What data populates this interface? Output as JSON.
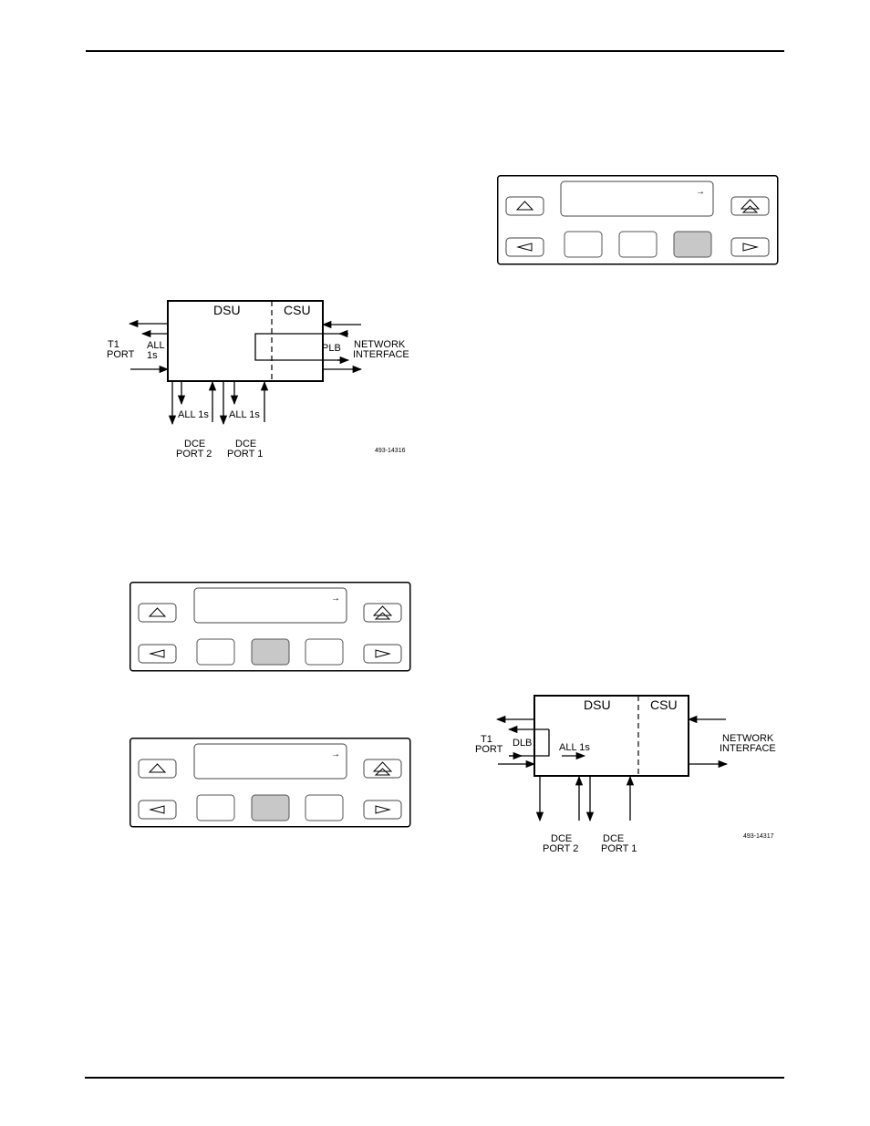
{
  "page": {
    "header_rule": true,
    "footer_rule": true
  },
  "panels": [
    {
      "id": "panel-1",
      "display_text": "",
      "cursor_glyph": "→",
      "function_keys": [
        {
          "label": "",
          "pressed": false
        },
        {
          "label": "",
          "pressed": false
        },
        {
          "label": "",
          "pressed": true
        }
      ],
      "nav_keys": {
        "up": "up-triangle-icon",
        "top": "double-up-triangle-icon",
        "left": "left-triangle-icon",
        "right": "right-triangle-icon"
      }
    },
    {
      "id": "panel-2",
      "display_text": "",
      "cursor_glyph": "→",
      "function_keys": [
        {
          "label": "",
          "pressed": false
        },
        {
          "label": "",
          "pressed": true
        },
        {
          "label": "",
          "pressed": false
        }
      ]
    },
    {
      "id": "panel-3",
      "display_text": "",
      "cursor_glyph": "→",
      "function_keys": [
        {
          "label": "",
          "pressed": false
        },
        {
          "label": "",
          "pressed": true
        },
        {
          "label": "",
          "pressed": false
        }
      ]
    }
  ],
  "colors": {
    "pressed_key": "#c8c8c8",
    "line": "#000000",
    "key_border": "#555555"
  },
  "diagrams": [
    {
      "id": "plb-diagram",
      "dsu_label": "DSU",
      "csu_label": "CSU",
      "t1_port_label": [
        "T1",
        "PORT"
      ],
      "all1s_left": [
        "ALL",
        "1s"
      ],
      "loop_label": "PLB",
      "network_label": [
        "NETWORK",
        "INTERFACE"
      ],
      "port_all1s_2": "ALL 1s",
      "port_all1s_1": "ALL 1s",
      "dce_port2_label": [
        "DCE",
        "PORT 2"
      ],
      "dce_port1_label": [
        "DCE",
        "PORT 1"
      ],
      "figure_id": "493-14316"
    },
    {
      "id": "dlb-diagram",
      "dsu_label": "DSU",
      "csu_label": "CSU",
      "t1_port_label": [
        "T1",
        "PORT"
      ],
      "loop_label": "DLB",
      "all1s_inner": "ALL 1s",
      "network_label": [
        "NETWORK",
        "INTERFACE"
      ],
      "dce_port2_label": [
        "DCE",
        "PORT 2"
      ],
      "dce_port1_label": [
        "DCE",
        "PORT 1"
      ],
      "figure_id": "493-14317"
    }
  ]
}
